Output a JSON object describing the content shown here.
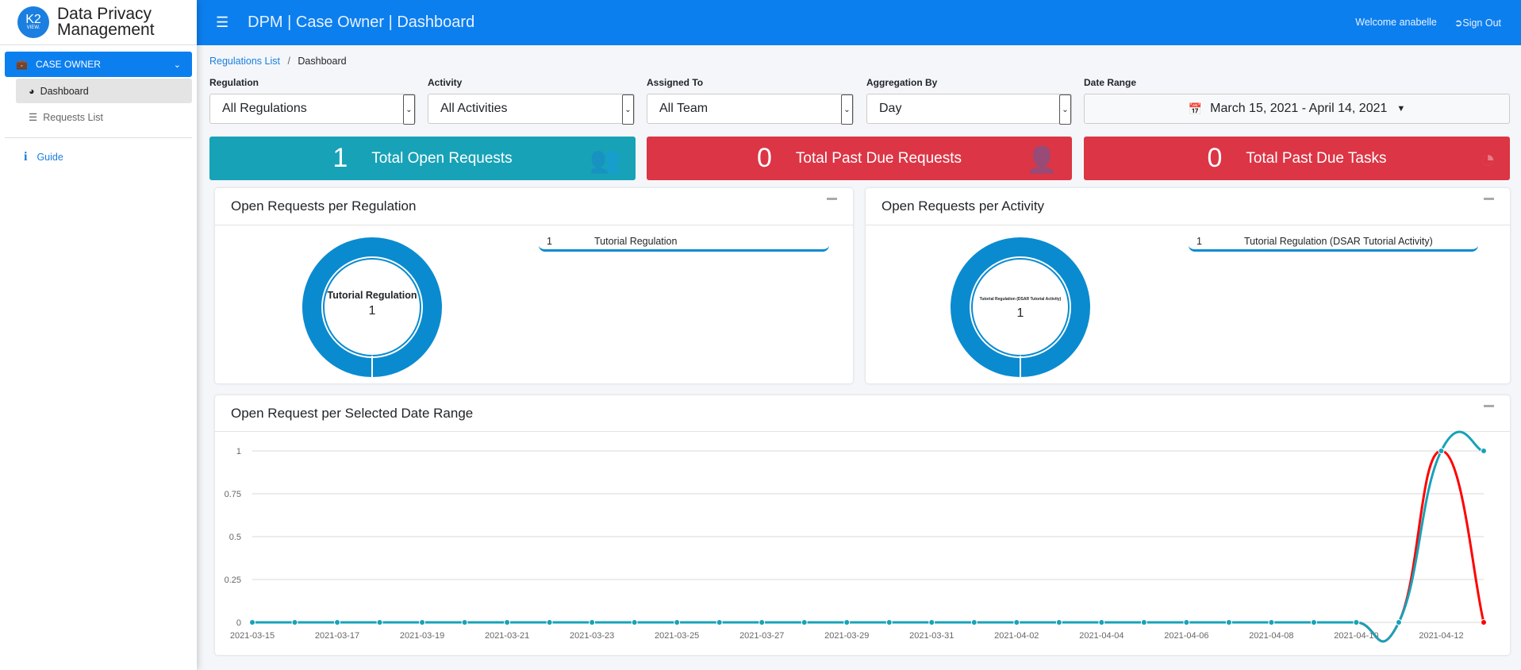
{
  "app": {
    "logo_mark": "K2",
    "logo_sub": "VIEW.",
    "name_line1": "Data Privacy",
    "name_line2": "Management"
  },
  "sidebar": {
    "section": "CASE OWNER",
    "items": [
      {
        "label": "Dashboard",
        "icon": "tachometer-icon",
        "active": true
      },
      {
        "label": "Requests List",
        "icon": "list-icon"
      }
    ],
    "guide": "Guide"
  },
  "header": {
    "title": "DPM | Case Owner | Dashboard",
    "welcome": "Welcome anabelle",
    "signout": "Sign Out"
  },
  "breadcrumb": {
    "link": "Regulations List",
    "sep": "/",
    "current": "Dashboard"
  },
  "filters": [
    {
      "label": "Regulation",
      "value": "All Regulations"
    },
    {
      "label": "Activity",
      "value": "All Activities"
    },
    {
      "label": "Assigned To",
      "value": "All Team"
    },
    {
      "label": "Aggregation By",
      "value": "Day"
    }
  ],
  "date_range": {
    "label": "Date Range",
    "value": "March 15, 2021 - April 14, 2021"
  },
  "cards": [
    {
      "num": "1",
      "label": "Total Open Requests",
      "color": "#17a2b8",
      "icon": "users-icon"
    },
    {
      "num": "0",
      "label": "Total Past Due Requests",
      "color": "#dc3545",
      "icon": "user-plus-icon"
    },
    {
      "num": "0",
      "label": "Total Past Due Tasks",
      "color": "#dc3545",
      "icon": "pie-chart-icon"
    }
  ],
  "colors": {
    "primary": "#0c7fef",
    "donut": "#0a8bd0",
    "line_teal": "#17a2b8",
    "line_red": "#ff0000"
  },
  "panels": {
    "regulation": {
      "title": "Open Requests per Regulation",
      "center_label": "Tutorial Regulation",
      "center_value": "1",
      "legend": [
        {
          "value": "1",
          "label": "Tutorial Regulation"
        }
      ]
    },
    "activity": {
      "title": "Open Requests per Activity",
      "center_label": "Tutorial Regulation (DSAR Tutorial Activity)",
      "center_value": "1",
      "legend": [
        {
          "value": "1",
          "label": "Tutorial Regulation (DSAR Tutorial Activity)"
        }
      ]
    },
    "range": {
      "title": "Open Request per Selected Date Range"
    }
  },
  "chart_data": {
    "type": "line",
    "ylim": [
      0,
      1
    ],
    "yticks": [
      "0",
      "0.25",
      "0.5",
      "0.75",
      "1"
    ],
    "x": [
      "2021-03-15",
      "2021-03-16",
      "2021-03-17",
      "2021-03-18",
      "2021-03-19",
      "2021-03-20",
      "2021-03-21",
      "2021-03-22",
      "2021-03-23",
      "2021-03-24",
      "2021-03-25",
      "2021-03-26",
      "2021-03-27",
      "2021-03-28",
      "2021-03-29",
      "2021-03-30",
      "2021-03-31",
      "2021-04-01",
      "2021-04-02",
      "2021-04-03",
      "2021-04-04",
      "2021-04-05",
      "2021-04-06",
      "2021-04-07",
      "2021-04-08",
      "2021-04-09",
      "2021-04-10",
      "2021-04-11",
      "2021-04-12",
      "2021-04-13"
    ],
    "xtick_labels": [
      "2021-03-15",
      "2021-03-17",
      "2021-03-19",
      "2021-03-21",
      "2021-03-23",
      "2021-03-25",
      "2021-03-27",
      "2021-03-29",
      "2021-03-31",
      "2021-04-02",
      "2021-04-04",
      "2021-04-06",
      "2021-04-08",
      "2021-04-10",
      "2021-04-12"
    ],
    "series": [
      {
        "color": "#ff0000",
        "values": [
          0,
          0,
          0,
          0,
          0,
          0,
          0,
          0,
          0,
          0,
          0,
          0,
          0,
          0,
          0,
          0,
          0,
          0,
          0,
          0,
          0,
          0,
          0,
          0,
          0,
          0,
          0,
          0,
          1,
          0
        ]
      },
      {
        "color": "#17a2b8",
        "values": [
          0,
          0,
          0,
          0,
          0,
          0,
          0,
          0,
          0,
          0,
          0,
          0,
          0,
          0,
          0,
          0,
          0,
          0,
          0,
          0,
          0,
          0,
          0,
          0,
          0,
          0,
          0,
          0,
          1,
          1
        ]
      }
    ],
    "grid": true
  }
}
